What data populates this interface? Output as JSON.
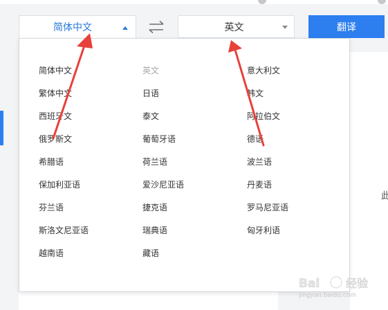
{
  "source_select": {
    "label": "简体中文"
  },
  "target_select": {
    "label": "英文"
  },
  "translate_button": {
    "label": "翻译"
  },
  "right_hint": "此",
  "languages": {
    "col1": [
      "简体中文",
      "繁体中文",
      "西班牙文",
      "俄罗斯文",
      "希腊语",
      "保加利亚语",
      "芬兰语",
      "斯洛文尼亚语",
      "越南语"
    ],
    "col2": [
      "英文",
      "日语",
      "泰文",
      "葡萄牙语",
      "荷兰语",
      "爱沙尼亚语",
      "捷克语",
      "瑞典语",
      "藏语"
    ],
    "col3": [
      "意大利文",
      "韩文",
      "阿拉伯文",
      "德语",
      "波兰语",
      "丹麦语",
      "罗马尼亚语",
      "匈牙利语"
    ]
  },
  "disabled_language": "英文",
  "watermark": {
    "logo_text": "Baidu经验",
    "url": "jingyan.baidu.com"
  },
  "colors": {
    "accent": "#2d7ff0",
    "selected_text": "#2878d8",
    "annotation_arrow": "#e8403a"
  }
}
